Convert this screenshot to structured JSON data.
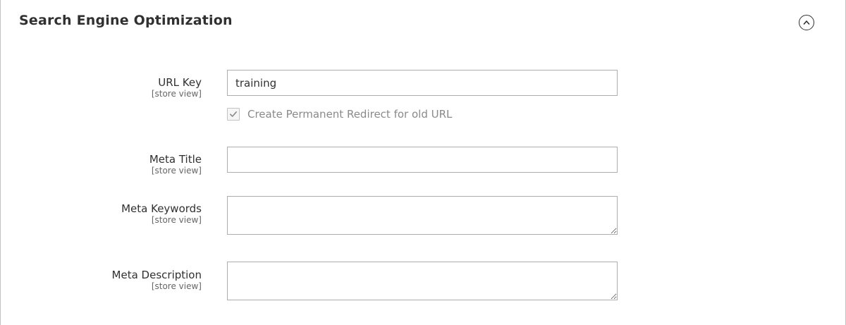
{
  "section": {
    "title": "Search Engine Optimization",
    "toggle_icon": "chevron-up-circle-icon"
  },
  "fields": {
    "url_key": {
      "label": "URL Key",
      "scope": "[store view]",
      "value": "training"
    },
    "redirect": {
      "label": "Create Permanent Redirect for old URL",
      "checked": true
    },
    "meta_title": {
      "label": "Meta Title",
      "scope": "[store view]",
      "value": ""
    },
    "meta_keywords": {
      "label": "Meta Keywords",
      "scope": "[store view]",
      "value": ""
    },
    "meta_description": {
      "label": "Meta Description",
      "scope": "[store view]",
      "value": ""
    }
  },
  "colors": {
    "text": "#303030",
    "scope_text": "#666666",
    "disabled_text": "#8a8a8a",
    "input_border": "#adadad"
  }
}
